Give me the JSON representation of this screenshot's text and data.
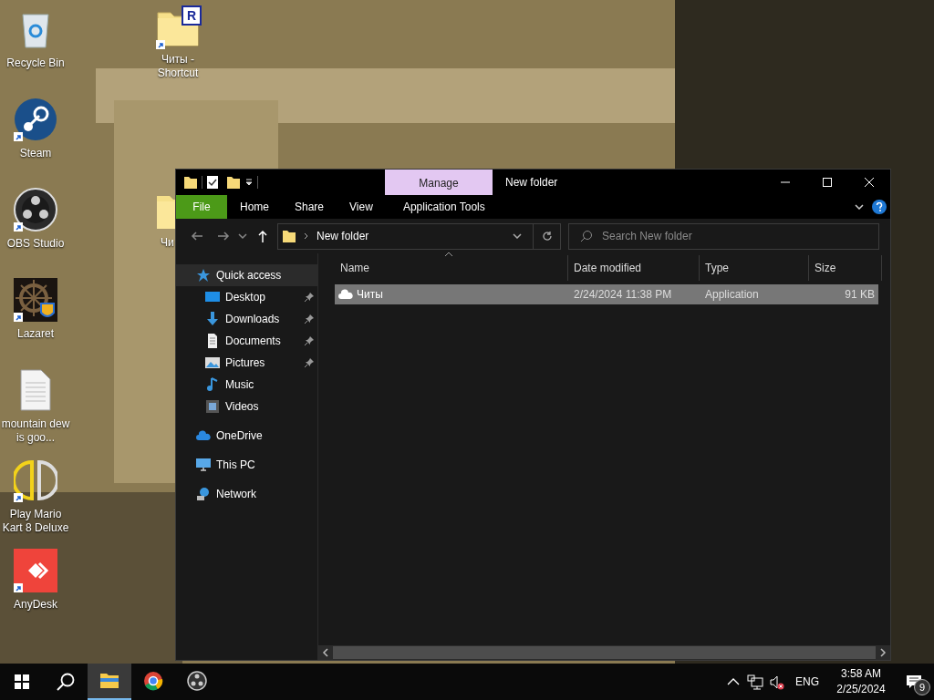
{
  "desktop_icons": [
    {
      "label": "Recycle Bin",
      "kind": "recycle",
      "shortcut": false
    },
    {
      "label": "Steam",
      "kind": "steam",
      "shortcut": true
    },
    {
      "label": "OBS Studio",
      "kind": "obs",
      "shortcut": true
    },
    {
      "label": "Lazaret",
      "kind": "lazaret",
      "shortcut": true
    },
    {
      "label": "mountain dew is goo...",
      "kind": "document",
      "shortcut": false
    },
    {
      "label": "Play Mario Kart 8 Deluxe",
      "kind": "yuzu",
      "shortcut": true
    },
    {
      "label": "AnyDesk",
      "kind": "anydesk",
      "shortcut": true
    }
  ],
  "desktop_folders": [
    {
      "label": "Читы - Shortcut",
      "badge": "R"
    },
    {
      "label": "Чи"
    }
  ],
  "explorer": {
    "title": "New folder",
    "contextual_tab": "Manage",
    "ribbon_tabs": [
      {
        "label": "File",
        "kind": "file",
        "selected": false
      },
      {
        "label": "Home",
        "kind": "tab",
        "selected": false
      },
      {
        "label": "Share",
        "kind": "tab",
        "selected": false
      },
      {
        "label": "View",
        "kind": "tab",
        "selected": false
      },
      {
        "label": "Application Tools",
        "kind": "tab",
        "selected": false
      }
    ],
    "address": {
      "path": "New folder"
    },
    "search": {
      "placeholder": "Search New folder"
    },
    "nav": [
      {
        "label": "Quick access",
        "kind": "star",
        "selected": true,
        "children": [
          {
            "label": "Desktop",
            "kind": "desktop",
            "pinned": true
          },
          {
            "label": "Downloads",
            "kind": "download",
            "pinned": true
          },
          {
            "label": "Documents",
            "kind": "documents",
            "pinned": true
          },
          {
            "label": "Pictures",
            "kind": "pictures",
            "pinned": true
          },
          {
            "label": "Music",
            "kind": "music",
            "pinned": false
          },
          {
            "label": "Videos",
            "kind": "videos",
            "pinned": false
          }
        ]
      },
      {
        "label": "OneDrive",
        "kind": "cloud",
        "selected": false
      },
      {
        "label": "This PC",
        "kind": "pc",
        "selected": false
      },
      {
        "label": "Network",
        "kind": "network",
        "selected": false
      }
    ],
    "columns": [
      "Name",
      "Date modified",
      "Type",
      "Size"
    ],
    "rows": [
      {
        "name": "Читы",
        "date": "2/24/2024 11:38 PM",
        "type": "Application",
        "size": "91 KB",
        "selected": true
      }
    ]
  },
  "taskbar": {
    "apps": [
      {
        "kind": "explorer",
        "active": true
      },
      {
        "kind": "chrome",
        "active": false
      },
      {
        "kind": "obs",
        "active": false
      }
    ],
    "language": "ENG",
    "time": "3:58 AM",
    "date": "2/25/2024",
    "notifications": "9"
  }
}
